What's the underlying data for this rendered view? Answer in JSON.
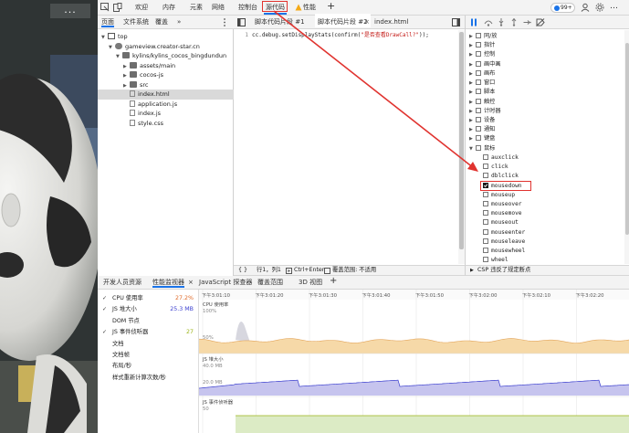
{
  "game": {
    "menu_button": "..."
  },
  "toolbar": {
    "tabs": [
      "欢迎",
      "内存",
      "元素",
      "网络",
      "控制台",
      "源代码",
      "性能"
    ],
    "active_tab": "源代码",
    "issues_count": "99+",
    "add": "+",
    "more": "…"
  },
  "navigator": {
    "tabs": [
      "页面",
      "文件系统",
      "覆盖"
    ],
    "more": "»",
    "tree": [
      {
        "label": "top",
        "depth": 0,
        "kind": "frame",
        "expanded": true
      },
      {
        "label": "gameview.creator-star.cn",
        "depth": 1,
        "kind": "cloud",
        "expanded": true
      },
      {
        "label": "kylins/kylins_cocos_bingdundun",
        "depth": 2,
        "kind": "folder",
        "expanded": true
      },
      {
        "label": "assets/main",
        "depth": 3,
        "kind": "folder",
        "expanded": false
      },
      {
        "label": "cocos-js",
        "depth": 3,
        "kind": "folder",
        "expanded": false
      },
      {
        "label": "src",
        "depth": 3,
        "kind": "folder",
        "expanded": false
      },
      {
        "label": "index.html",
        "depth": 3,
        "kind": "file",
        "selected": true
      },
      {
        "label": "application.js",
        "depth": 3,
        "kind": "file"
      },
      {
        "label": "index.js",
        "depth": 3,
        "kind": "file"
      },
      {
        "label": "style.css",
        "depth": 3,
        "kind": "file"
      }
    ]
  },
  "editor": {
    "tabs": [
      {
        "label": "脚本代码片段 #1",
        "active": false
      },
      {
        "label": "脚本代码片段 #2",
        "active": true
      },
      {
        "label": "index.html",
        "active": false
      }
    ],
    "line_number": "1",
    "code_prefix": "cc.debug.setDisplayStats(confirm(",
    "code_string": "\"是否查看DrawCall?\"",
    "code_suffix": "));",
    "status": {
      "braces": "{ }",
      "position": "行1，列1",
      "run": "Ctrl+Enter",
      "coverage": "覆盖范围: 不适用"
    }
  },
  "breakpoints": {
    "items": [
      {
        "label": "同/放",
        "type": "category"
      },
      {
        "label": "指针",
        "type": "category"
      },
      {
        "label": "控制",
        "type": "category"
      },
      {
        "label": "画中画",
        "type": "category"
      },
      {
        "label": "画布",
        "type": "category"
      },
      {
        "label": "窗口",
        "type": "category"
      },
      {
        "label": "脚本",
        "type": "category"
      },
      {
        "label": "触控",
        "type": "category"
      },
      {
        "label": "计时器",
        "type": "category"
      },
      {
        "label": "设备",
        "type": "category"
      },
      {
        "label": "通知",
        "type": "category"
      },
      {
        "label": "键盘",
        "type": "category"
      },
      {
        "label": "鼠标",
        "type": "category",
        "expanded": true
      },
      {
        "label": "auxclick",
        "type": "event"
      },
      {
        "label": "click",
        "type": "event"
      },
      {
        "label": "dblclick",
        "type": "event"
      },
      {
        "label": "mousedown",
        "type": "event",
        "checked": true,
        "highlight": true
      },
      {
        "label": "mouseup",
        "type": "event"
      },
      {
        "label": "mouseover",
        "type": "event"
      },
      {
        "label": "mousemove",
        "type": "event"
      },
      {
        "label": "mouseout",
        "type": "event"
      },
      {
        "label": "mouseenter",
        "type": "event"
      },
      {
        "label": "mouseleave",
        "type": "event"
      },
      {
        "label": "mousewheel",
        "type": "event"
      },
      {
        "label": "wheel",
        "type": "event"
      },
      {
        "label": "contextmenu",
        "type": "event"
      }
    ],
    "csp": "CSP 违反了规定断点"
  },
  "drawer": {
    "tabs": [
      {
        "label": "开发人员资源",
        "active": false
      },
      {
        "label": "性能监视器",
        "active": true,
        "closable": true
      },
      {
        "label": "JavaScript 探查器",
        "active": false
      },
      {
        "label": "覆盖范围",
        "active": false
      },
      {
        "label": "3D 视图",
        "active": false
      }
    ],
    "close": "×",
    "add": "+",
    "metrics": [
      {
        "label": "CPU 使用率",
        "value": "27.2%",
        "checked": true,
        "color": "#e06a28"
      },
      {
        "label": "JS 堆大小",
        "value": "25.3 MB",
        "checked": true,
        "color": "#3b3fcf"
      },
      {
        "label": "DOM 节点",
        "value": "",
        "checked": false,
        "color": ""
      },
      {
        "label": "JS 事件侦听器",
        "value": "27",
        "checked": true,
        "color": "#9cb51a"
      },
      {
        "label": "文档",
        "value": "",
        "checked": false,
        "color": ""
      },
      {
        "label": "文档帧",
        "value": "",
        "checked": false,
        "color": ""
      },
      {
        "label": "布局/秒",
        "value": "",
        "checked": false,
        "color": ""
      },
      {
        "label": "样式重新计算次数/秒",
        "value": "",
        "checked": false,
        "color": ""
      }
    ],
    "timeline": {
      "ticks": [
        "下午3:01:10",
        "下午3:01:20",
        "下午3:01:30",
        "下午3:01:40",
        "下午3:01:50",
        "下午3:02:00",
        "下午3:02:10",
        "下午3:02:20",
        "下午3:02:30"
      ],
      "charts": [
        {
          "title": "CPU 使用率",
          "scale": [
            "100%",
            "50%"
          ]
        },
        {
          "title": "JS 堆大小",
          "scale": [
            "40.0 MB",
            "20.0 MB"
          ]
        },
        {
          "title": "JS 事件侦听器",
          "scale": [
            "50",
            "0"
          ]
        }
      ]
    }
  },
  "colors": {
    "accent": "#1a73e8",
    "annotation": "#e0332f",
    "cpu_fill": "#f6d9a8",
    "heap_fill": "#c6c4ee",
    "heap_line": "#3b3fcf",
    "listeners_fill": "#dcebc5",
    "listeners_line": "#9cb51a"
  }
}
